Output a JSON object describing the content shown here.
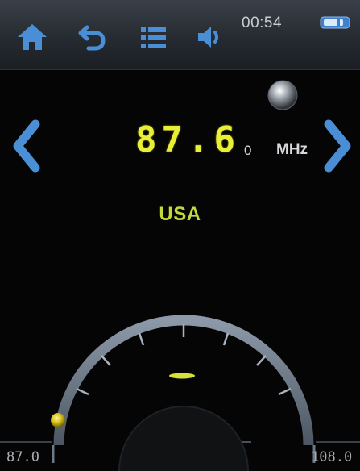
{
  "status_bar": {
    "time": "00:54"
  },
  "tuner": {
    "frequency": "87.6",
    "frequency_suffix": "0",
    "unit": "MHz",
    "region": "USA",
    "range_min_label": "87.0",
    "range_max_label": "108.0",
    "range_min": 87.0,
    "range_max": 108.0
  },
  "icons": {
    "home": "home-icon",
    "back": "back-arrow-icon",
    "list": "list-icon",
    "volume": "speaker-icon",
    "battery": "battery-icon",
    "prev": "chevron-left-icon",
    "next": "chevron-right-icon",
    "knob": "knob-icon"
  },
  "colors": {
    "accent_blue": "#4a8fd6",
    "frequency_yellow": "#e9ef37",
    "region_green": "#c3d93a",
    "dial_gray": "#7d8a99"
  }
}
